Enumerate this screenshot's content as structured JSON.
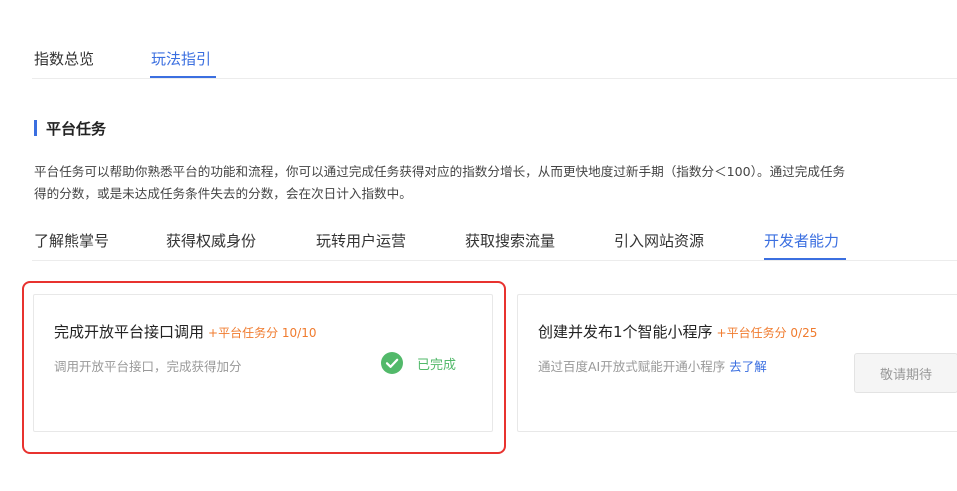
{
  "top_tabs": [
    {
      "label": "指数总览",
      "active": false
    },
    {
      "label": "玩法指引",
      "active": true
    }
  ],
  "section": {
    "title": "平台任务",
    "desc_line1": "平台任务可以帮助你熟悉平台的功能和流程，你可以通过完成任务获得对应的指数分增长，从而更快地度过新手期（指数分＜100）。通过完成任务",
    "desc_line2": "得的分数，或是未达成任务条件失去的分数，会在次日计入指数中。"
  },
  "category_tabs": [
    {
      "label": "了解熊掌号"
    },
    {
      "label": "获得权威身份"
    },
    {
      "label": "玩转用户运营"
    },
    {
      "label": "获取搜索流量"
    },
    {
      "label": "引入网站资源"
    },
    {
      "label": "开发者能力",
      "active": true
    }
  ],
  "cards": [
    {
      "title": "完成开放平台接口调用",
      "points": "+平台任务分 10/10",
      "subtitle": "调用开放平台接口，完成获得加分",
      "status": "已完成"
    },
    {
      "title": "创建并发布1个智能小程序",
      "points": "+平台任务分 0/25",
      "subtitle": "通过百度AI开放式赋能开通小程序",
      "link": "去了解",
      "button": "敬请期待"
    }
  ],
  "colors": {
    "accent": "#3b6fe0",
    "points": "#f07b2e",
    "success": "#52b96a",
    "highlight": "#e8322f"
  },
  "icons": {
    "done": "check-circle-icon"
  }
}
